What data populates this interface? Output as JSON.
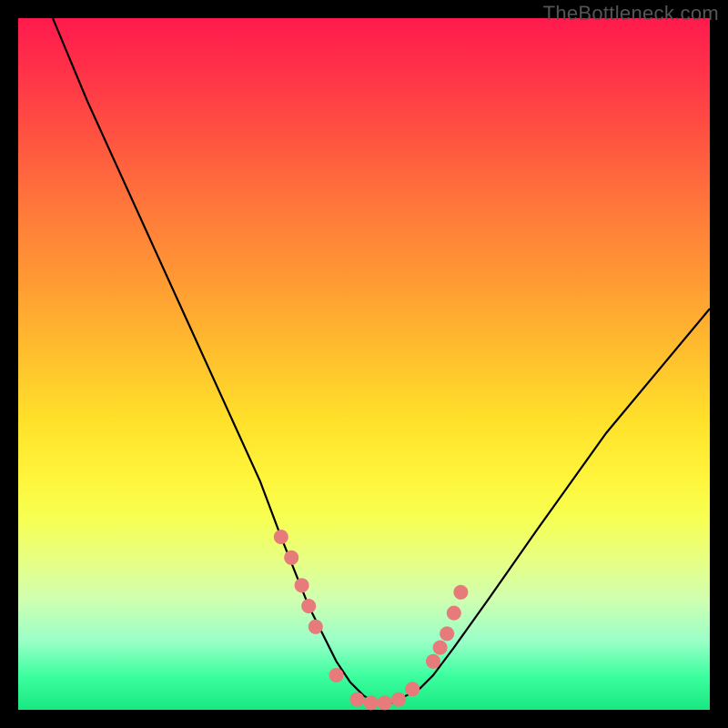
{
  "watermark": "TheBottleneck.com",
  "chart_data": {
    "type": "line",
    "title": "",
    "xlabel": "",
    "ylabel": "",
    "xlim": [
      0,
      100
    ],
    "ylim": [
      0,
      100
    ],
    "series": [
      {
        "name": "bottleneck-curve",
        "x": [
          5,
          10,
          15,
          20,
          25,
          30,
          35,
          38,
          40,
          42,
          44,
          46,
          48,
          50,
          52,
          54,
          56,
          58,
          60,
          63,
          68,
          75,
          85,
          95,
          100
        ],
        "values": [
          100,
          88,
          77,
          66,
          55,
          44,
          33,
          25,
          20,
          15,
          11,
          7,
          4,
          2,
          1,
          1,
          2,
          3,
          5,
          9,
          16,
          26,
          40,
          52,
          58
        ]
      }
    ],
    "markers": {
      "name": "highlight-dots",
      "color": "#e77a7a",
      "x": [
        38,
        39.5,
        41,
        42,
        43,
        46,
        49,
        51,
        53,
        55,
        57,
        60,
        61,
        62,
        63,
        64
      ],
      "values": [
        25,
        22,
        18,
        15,
        12,
        5,
        1.5,
        1,
        1,
        1.5,
        3,
        7,
        9,
        11,
        14,
        17
      ]
    },
    "background_gradient": {
      "top": "#ff1a4d",
      "bottom": "#18e880"
    }
  }
}
